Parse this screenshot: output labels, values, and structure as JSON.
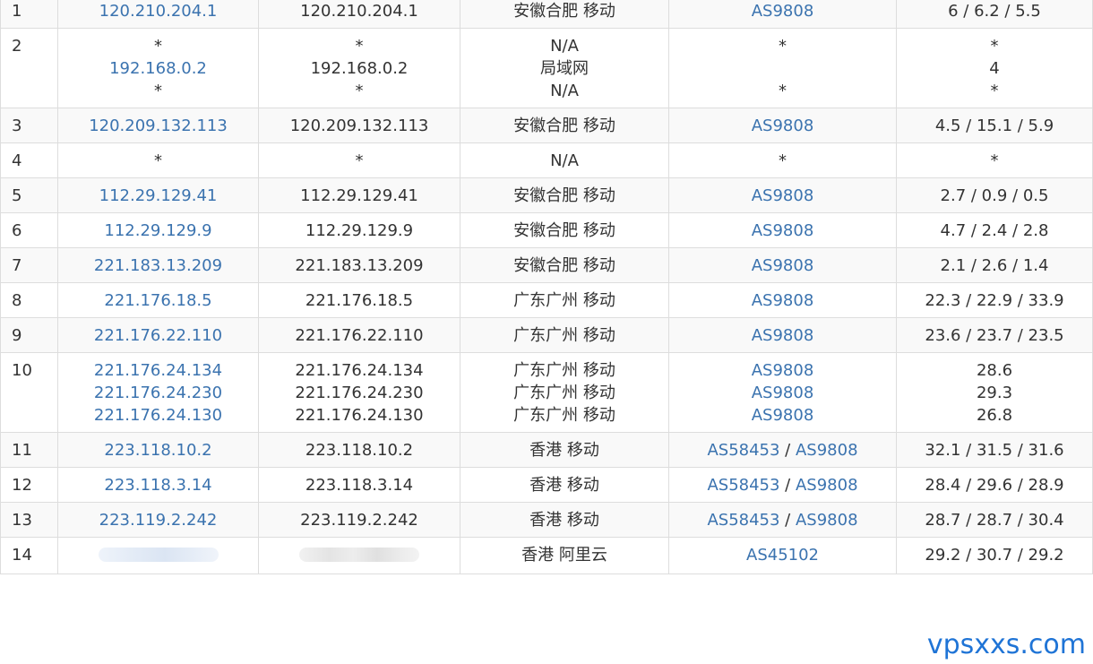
{
  "rows": [
    {
      "hop": "1",
      "ip": [
        "120.210.204.1"
      ],
      "host": [
        "120.210.204.1"
      ],
      "loc": [
        "安徽合肥 移动"
      ],
      "as": [
        [
          "AS9808"
        ]
      ],
      "rtt": [
        "6 / 6.2 / 5.5"
      ]
    },
    {
      "hop": "2",
      "ip": [
        "*",
        "192.168.0.2",
        "*"
      ],
      "host": [
        "*",
        "192.168.0.2",
        "*"
      ],
      "loc": [
        "N/A",
        "局域网",
        "N/A"
      ],
      "as": [
        [
          "*"
        ],
        [],
        [
          "*"
        ]
      ],
      "rtt": [
        "*",
        "4",
        "*"
      ]
    },
    {
      "hop": "3",
      "ip": [
        "120.209.132.113"
      ],
      "host": [
        "120.209.132.113"
      ],
      "loc": [
        "安徽合肥 移动"
      ],
      "as": [
        [
          "AS9808"
        ]
      ],
      "rtt": [
        "4.5 / 15.1 / 5.9"
      ]
    },
    {
      "hop": "4",
      "ip": [
        "*"
      ],
      "host": [
        "*"
      ],
      "loc": [
        "N/A"
      ],
      "as": [
        [
          "*"
        ]
      ],
      "rtt": [
        "*"
      ]
    },
    {
      "hop": "5",
      "ip": [
        "112.29.129.41"
      ],
      "host": [
        "112.29.129.41"
      ],
      "loc": [
        "安徽合肥 移动"
      ],
      "as": [
        [
          "AS9808"
        ]
      ],
      "rtt": [
        "2.7 / 0.9 / 0.5"
      ]
    },
    {
      "hop": "6",
      "ip": [
        "112.29.129.9"
      ],
      "host": [
        "112.29.129.9"
      ],
      "loc": [
        "安徽合肥 移动"
      ],
      "as": [
        [
          "AS9808"
        ]
      ],
      "rtt": [
        "4.7 / 2.4 / 2.8"
      ]
    },
    {
      "hop": "7",
      "ip": [
        "221.183.13.209"
      ],
      "host": [
        "221.183.13.209"
      ],
      "loc": [
        "安徽合肥 移动"
      ],
      "as": [
        [
          "AS9808"
        ]
      ],
      "rtt": [
        "2.1 / 2.6 / 1.4"
      ]
    },
    {
      "hop": "8",
      "ip": [
        "221.176.18.5"
      ],
      "host": [
        "221.176.18.5"
      ],
      "loc": [
        "广东广州 移动"
      ],
      "as": [
        [
          "AS9808"
        ]
      ],
      "rtt": [
        "22.3 / 22.9 / 33.9"
      ]
    },
    {
      "hop": "9",
      "ip": [
        "221.176.22.110"
      ],
      "host": [
        "221.176.22.110"
      ],
      "loc": [
        "广东广州 移动"
      ],
      "as": [
        [
          "AS9808"
        ]
      ],
      "rtt": [
        "23.6 / 23.7 / 23.5"
      ]
    },
    {
      "hop": "10",
      "ip": [
        "221.176.24.134",
        "221.176.24.230",
        "221.176.24.130"
      ],
      "host": [
        "221.176.24.134",
        "221.176.24.230",
        "221.176.24.130"
      ],
      "loc": [
        "广东广州 移动",
        "广东广州 移动",
        "广东广州 移动"
      ],
      "as": [
        [
          "AS9808"
        ],
        [
          "AS9808"
        ],
        [
          "AS9808"
        ]
      ],
      "rtt": [
        "28.6",
        "29.3",
        "26.8"
      ]
    },
    {
      "hop": "11",
      "ip": [
        "223.118.10.2"
      ],
      "host": [
        "223.118.10.2"
      ],
      "loc": [
        "香港 移动"
      ],
      "as": [
        [
          "AS58453",
          "AS9808"
        ]
      ],
      "rtt": [
        "32.1 / 31.5 / 31.6"
      ]
    },
    {
      "hop": "12",
      "ip": [
        "223.118.3.14"
      ],
      "host": [
        "223.118.3.14"
      ],
      "loc": [
        "香港 移动"
      ],
      "as": [
        [
          "AS58453",
          "AS9808"
        ]
      ],
      "rtt": [
        "28.4 / 29.6 / 28.9"
      ]
    },
    {
      "hop": "13",
      "ip": [
        "223.119.2.242"
      ],
      "host": [
        "223.119.2.242"
      ],
      "loc": [
        "香港 移动"
      ],
      "as": [
        [
          "AS58453",
          "AS9808"
        ]
      ],
      "rtt": [
        "28.7 / 28.7 / 30.4"
      ]
    },
    {
      "hop": "14",
      "ip": [],
      "host": [],
      "loc": [
        "香港 阿里云"
      ],
      "as": [
        [
          "AS45102"
        ]
      ],
      "rtt": [
        "29.2 / 30.7 / 29.2"
      ],
      "redacted": true
    }
  ],
  "as_separator": " / ",
  "watermark": "vpsxxs.com"
}
